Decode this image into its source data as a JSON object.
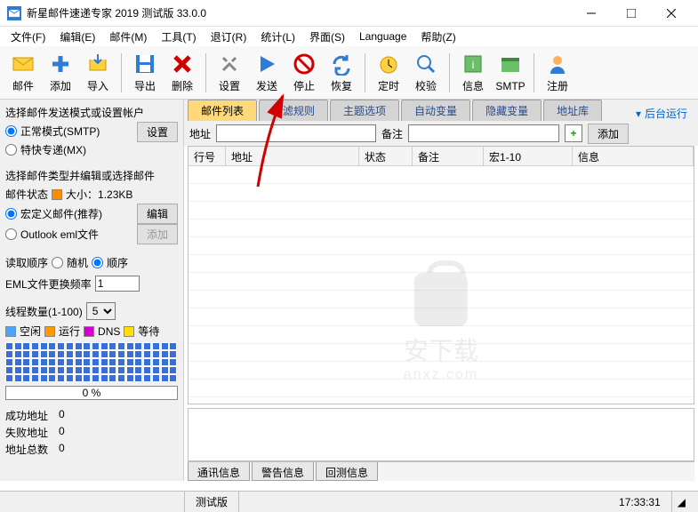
{
  "window": {
    "title": "新星邮件速递专家 2019 测试版 33.0.0"
  },
  "menu": {
    "file": "文件(F)",
    "edit": "编辑(E)",
    "mail": "邮件(M)",
    "tool": "工具(T)",
    "unsub": "退订(R)",
    "stat": "统计(L)",
    "view": "界面(S)",
    "lang": "Language",
    "help": "帮助(Z)"
  },
  "toolbar": {
    "mail": "邮件",
    "add": "添加",
    "import": "导入",
    "export": "导出",
    "delete": "删除",
    "settings": "设置",
    "send": "发送",
    "stop": "停止",
    "restore": "恢复",
    "timer": "定时",
    "verify": "校验",
    "info": "信息",
    "smtp": "SMTP",
    "register": "注册"
  },
  "left": {
    "mode_title": "选择邮件发送模式或设置帐户",
    "mode_normal": "正常模式(SMTP)",
    "mode_express": "特快专递(MX)",
    "settings_btn": "设置",
    "type_title": "选择邮件类型并编辑或选择邮件",
    "status_label": "邮件状态",
    "size_label": "大小：1.23KB",
    "macro_mail": "宏定义邮件(推荐)",
    "outlook_mail": "Outlook eml文件",
    "edit_btn": "编辑",
    "add_btn": "添加",
    "read_order": "读取顺序",
    "random": "随机",
    "sequential": "顺序",
    "eml_freq": "EML文件更换频率",
    "eml_val": "1",
    "thread_label": "线程数量(1-100)",
    "thread_val": "5",
    "idle": "空闲",
    "running": "运行",
    "dns": "DNS",
    "waiting": "等待",
    "progress": "0 %",
    "success": "成功地址",
    "success_v": "0",
    "fail": "失败地址",
    "fail_v": "0",
    "total": "地址总数",
    "total_v": "0"
  },
  "tabs": {
    "list": "邮件列表",
    "filter": "过滤规则",
    "subject": "主题选项",
    "auto": "自动变量",
    "hidden": "隐藏变量",
    "addr": "地址库",
    "bgrun": "后台运行"
  },
  "addr_row": {
    "addr_lbl": "地址",
    "note_lbl": "备注",
    "add_btn": "添加"
  },
  "table": {
    "row": "行号",
    "addr": "地址",
    "status": "状态",
    "note": "备注",
    "macro": "宏1-10",
    "info": "信息"
  },
  "log_tabs": {
    "comm": "通讯信息",
    "warn": "警告信息",
    "reply": "回测信息"
  },
  "statusbar": {
    "version": "测试版",
    "time": "17:33:31"
  },
  "watermark": {
    "text": "安下载",
    "sub": "anxz.com"
  },
  "colors": {
    "idle": "#4aa3ff",
    "running": "#ff9900",
    "dns": "#d400d4",
    "waiting": "#ffe000",
    "status": "#ff8c00"
  }
}
